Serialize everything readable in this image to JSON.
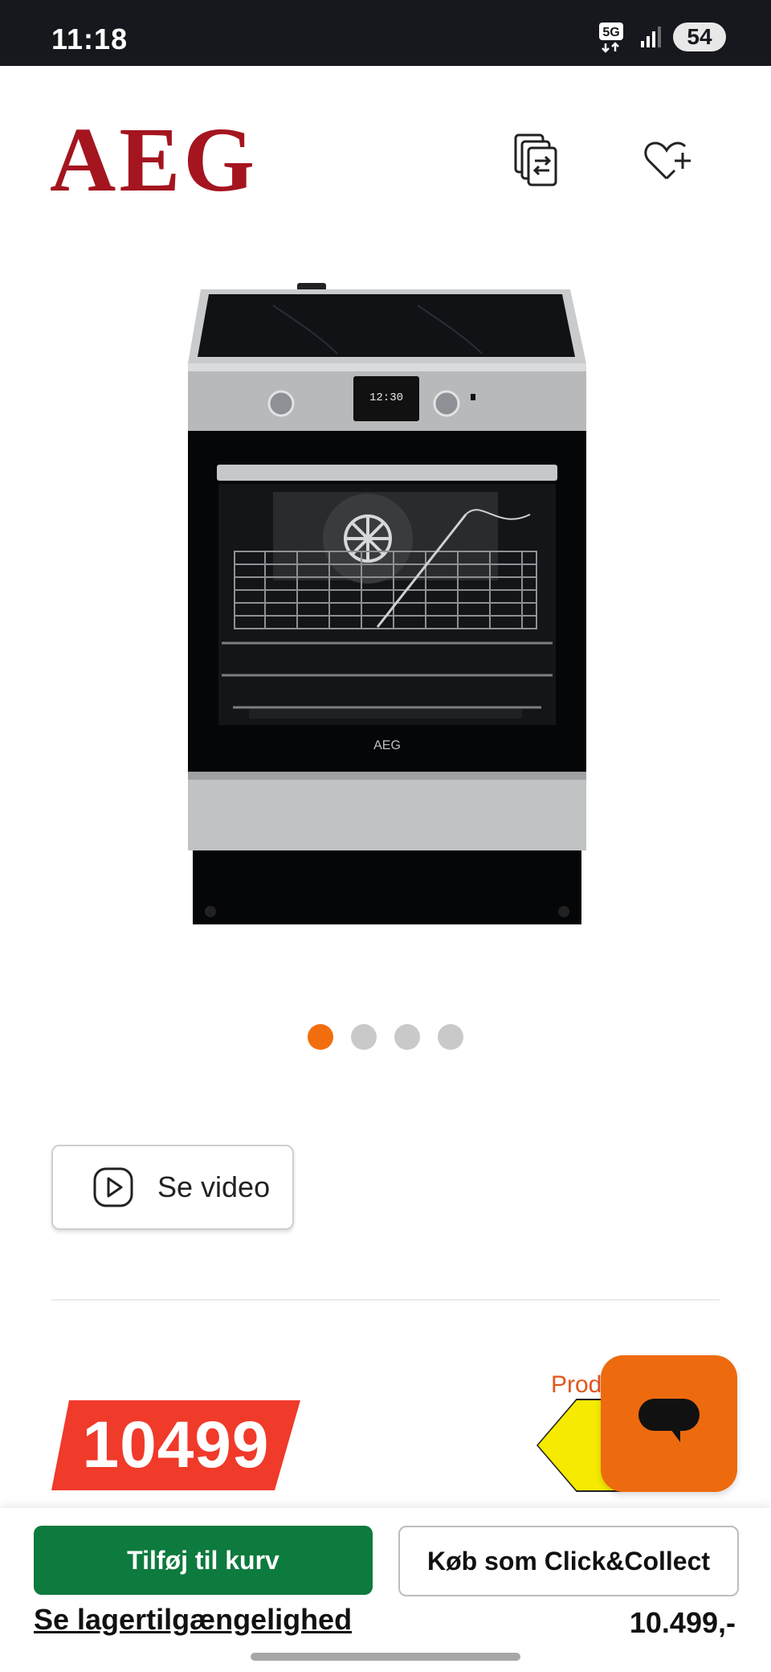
{
  "status_bar": {
    "time": "11:18",
    "network": "5G",
    "battery": "54"
  },
  "header": {
    "brand": "AEG",
    "icons": [
      "compare-icon",
      "wishlist-add-icon"
    ]
  },
  "product": {
    "image_icon": "oven-range-product-image",
    "oven_brand_text": "AEG",
    "display_time": "12:30",
    "carousel": {
      "count": 4,
      "active_index": 0
    },
    "video_button_label": "Se video",
    "price": "10499",
    "energy_label_text": "Prod"
  },
  "colors": {
    "brand_red": "#a4151f",
    "price_red": "#f03a2a",
    "accent_orange": "#f26d0e",
    "cart_green": "#0d7a3e",
    "energy_yellow": "#f5ea00"
  },
  "action_bar": {
    "add_to_cart_label": "Tilføj til kurv",
    "click_collect_label": "Køb som Click&Collect",
    "stock_link_label": "Se lagertilgængelighed",
    "price_label": "10.499,-"
  }
}
